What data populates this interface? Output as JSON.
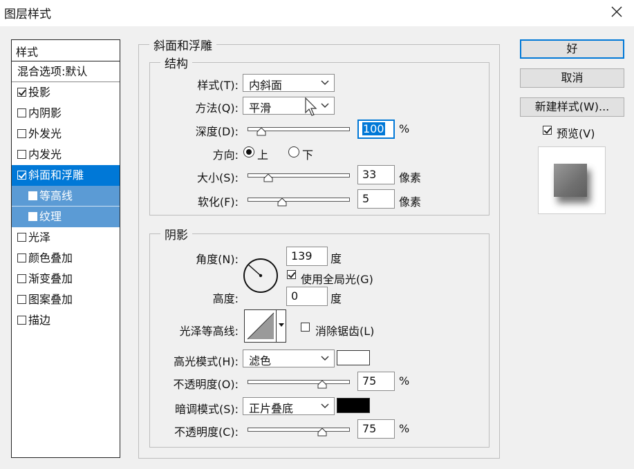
{
  "window": {
    "title": "图层样式"
  },
  "styles_panel": {
    "header": "样式",
    "blend_options": "混合选项:默认",
    "items": [
      {
        "label": "投影",
        "checked": true
      },
      {
        "label": "内阴影",
        "checked": false
      },
      {
        "label": "外发光",
        "checked": false
      },
      {
        "label": "内发光",
        "checked": false
      },
      {
        "label": "斜面和浮雕",
        "checked": true,
        "selected": true
      },
      {
        "label": "等高线",
        "checked": false,
        "sub": true
      },
      {
        "label": "纹理",
        "checked": false,
        "sub": true
      },
      {
        "label": "光泽",
        "checked": false
      },
      {
        "label": "颜色叠加",
        "checked": false
      },
      {
        "label": "渐变叠加",
        "checked": false
      },
      {
        "label": "图案叠加",
        "checked": false
      },
      {
        "label": "描边",
        "checked": false
      }
    ]
  },
  "bevel": {
    "title": "斜面和浮雕",
    "structure": {
      "title": "结构",
      "style_label": "样式(T):",
      "style_value": "内斜面",
      "technique_label": "方法(Q):",
      "technique_value": "平滑",
      "depth_label": "深度(D):",
      "depth_value": "100",
      "depth_unit": "%",
      "depth_fraction": 0.1,
      "direction_label": "方向:",
      "direction_up": "上",
      "direction_down": "下",
      "direction_selected": "上",
      "size_label": "大小(S):",
      "size_value": "33",
      "size_unit": "像素",
      "size_fraction": 0.17,
      "soften_label": "软化(F):",
      "soften_value": "5",
      "soften_unit": "像素",
      "soften_fraction": 0.32
    },
    "shading": {
      "title": "阴影",
      "angle_label": "角度(N):",
      "angle_value": "139",
      "angle_unit": "度",
      "global_light_label": "使用全局光(G)",
      "global_light_checked": true,
      "altitude_label": "高度:",
      "altitude_value": "0",
      "altitude_unit": "度",
      "gloss_contour_label": "光泽等高线:",
      "anti_aliased_label": "消除锯齿(L)",
      "anti_aliased_checked": false,
      "highlight_mode_label": "高光模式(H):",
      "highlight_mode_value": "滤色",
      "highlight_color": "#ffffff",
      "highlight_opacity_label": "不透明度(O):",
      "highlight_opacity_value": "75",
      "highlight_opacity_unit": "%",
      "highlight_opacity_fraction": 0.75,
      "shadow_mode_label": "暗调模式(S):",
      "shadow_mode_value": "正片叠底",
      "shadow_color": "#000000",
      "shadow_opacity_label": "不透明度(C):",
      "shadow_opacity_value": "75",
      "shadow_opacity_unit": "%",
      "shadow_opacity_fraction": 0.75
    }
  },
  "buttons": {
    "ok": "好",
    "cancel": "取消",
    "new_style": "新建样式(W)...",
    "preview_label": "预览(V)",
    "preview_checked": true
  }
}
